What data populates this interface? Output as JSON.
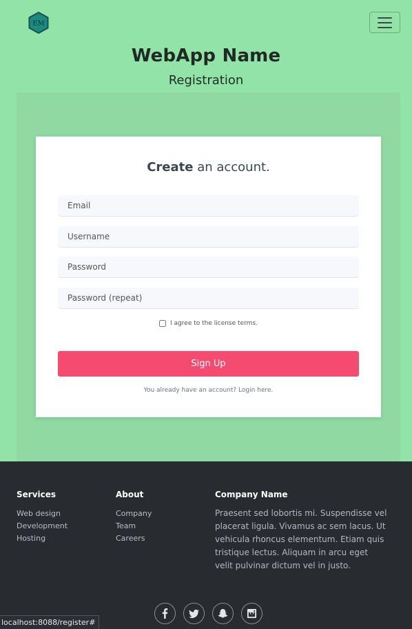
{
  "header": {
    "logo_text": "EM",
    "logo_color": "#1d8a7e",
    "menu_icon": "hamburger-icon",
    "app_title": "WebApp Name",
    "page_subtitle": "Registration"
  },
  "form": {
    "title_bold": "Create",
    "title_rest": " an account.",
    "email_placeholder": "Email",
    "username_placeholder": "Username",
    "password_placeholder": "Password",
    "password_repeat_placeholder": "Password (repeat)",
    "agree_label": "I agree to the license terms.",
    "agree_checked": false,
    "submit_label": "Sign Up",
    "login_note": "You already have an account? Login here.",
    "accent_color": "#f64b70"
  },
  "footer": {
    "services": {
      "heading": "Services",
      "items": [
        "Web design",
        "Development",
        "Hosting"
      ]
    },
    "about": {
      "heading": "About",
      "items": [
        "Company",
        "Team",
        "Careers"
      ]
    },
    "company": {
      "heading": "Company Name",
      "text": "Praesent sed lobortis mi. Suspendisse vel placerat ligula. Vivamus ac sem lacus. Ut vehicula rhoncus elementum. Etiam quis tristique lectus. Aliquam in arcu eget velit pulvinar dictum vel in justo."
    },
    "social_icons": [
      "facebook-icon",
      "twitter-icon",
      "snapchat-icon",
      "instagram-icon"
    ]
  },
  "status_url": "localhost:8088/register#",
  "colors": {
    "page_bg": "#91e3a8",
    "footer_bg": "#282b30"
  }
}
